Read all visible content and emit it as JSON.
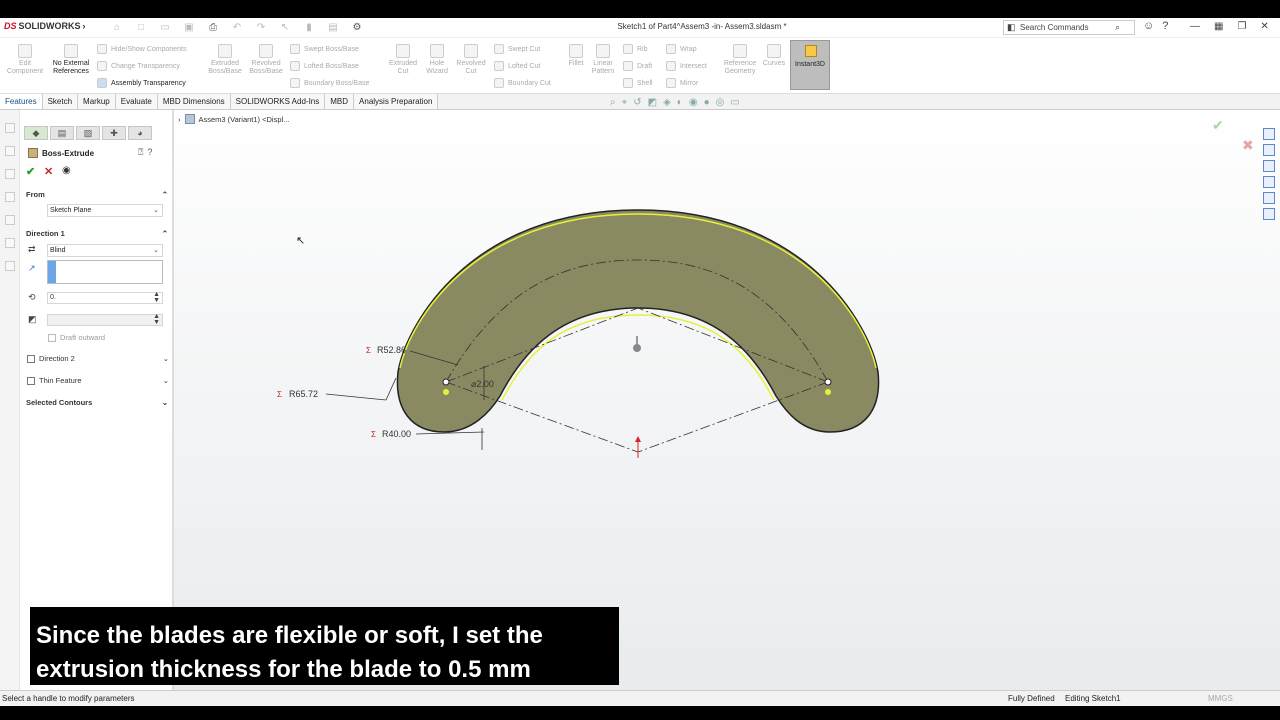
{
  "app": {
    "brand": "SOLIDWORKS",
    "ds": "DS",
    "doc_title": "Sketch1 of Part4^Assem3 -in- Assem3.sldasm *",
    "search_placeholder": "Search Commands"
  },
  "ribbon": {
    "edit_component": "Edit Component",
    "no_ext_refs": "No External References",
    "hide_show": "Hide/Show Components",
    "change_transparency": "Change Transparency",
    "assembly_transparency": "Assembly Transparency",
    "extruded_boss": "Extruded Boss/Base",
    "revolved_boss": "Revolved Boss/Base",
    "swept_boss": "Swept Boss/Base",
    "lofted_boss": "Lofted Boss/Base",
    "boundary_boss": "Boundary Boss/Base",
    "extruded_cut": "Extruded Cut",
    "hole_wizard": "Hole Wizard",
    "revolved_cut": "Revolved Cut",
    "swept_cut": "Swept Cut",
    "lofted_cut": "Lofted Cut",
    "boundary_cut": "Boundary Cut",
    "fillet": "Fillet",
    "linear_pattern": "Linear Pattern",
    "rib": "Rib",
    "draft": "Draft",
    "shell": "Shell",
    "wrap": "Wrap",
    "intersect": "Intersect",
    "mirror": "Mirror",
    "reference_geometry": "Reference Geometry",
    "curves": "Curves",
    "instant3d": "Instant3D"
  },
  "tabs": [
    "Features",
    "Sketch",
    "Markup",
    "Evaluate",
    "MBD Dimensions",
    "SOLIDWORKS Add-Ins",
    "MBD",
    "Analysis Preparation"
  ],
  "tree": {
    "root": "Assem3 (Variant1) <Displ..."
  },
  "property_manager": {
    "title": "Boss-Extrude",
    "from_label": "From",
    "from_value": "Sketch Plane",
    "direction1_label": "Direction 1",
    "end_condition": "Blind",
    "depth_value": "0.",
    "draft_outward": "Draft outward",
    "direction2": "Direction 2",
    "thin_feature": "Thin Feature",
    "selected_contours": "Selected Contours"
  },
  "dimensions": {
    "r1": "R52.86",
    "r2": "R65.72",
    "r3": "R40.00",
    "d1": "⌀2.00"
  },
  "caption": {
    "line1": "Since the blades are flexible or soft, I set the",
    "line2": "extrusion thickness for the blade to 0.5 mm"
  },
  "status": {
    "hint": "Select a handle to modify parameters",
    "fully_defined": "Fully Defined",
    "editing": "Editing Sketch1",
    "units": "MMGS"
  },
  "colors": {
    "part_fill": "#8a8a62",
    "highlight": "#e6f03c",
    "accent": "#1a4f8b"
  }
}
